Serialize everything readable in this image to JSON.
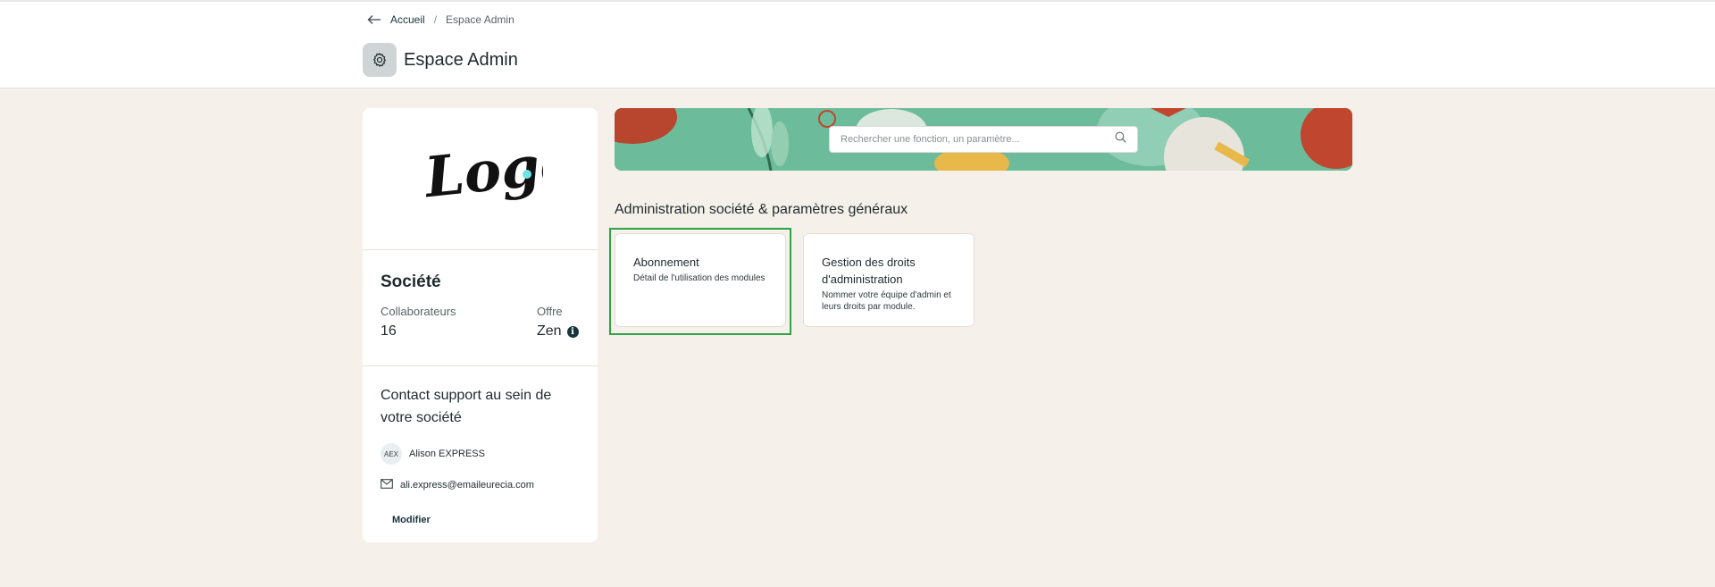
{
  "breadcrumb": {
    "home": "Accueil",
    "separator": "/",
    "current": "Espace Admin"
  },
  "header": {
    "title": "Espace Admin",
    "icon": "gear-icon"
  },
  "company": {
    "logo_text": "Logo",
    "name": "Société",
    "collaborators_label": "Collaborateurs",
    "collaborators_value": "16",
    "offer_label": "Offre",
    "offer_value": "Zen"
  },
  "support": {
    "title": "Contact support au sein de votre société",
    "avatar_initials": "AEX",
    "contact_name": "Alison EXPRESS",
    "email": "ali.express@emaileurecia.com",
    "modify_label": "Modifier"
  },
  "search": {
    "placeholder": "Rechercher une fonction, un paramètre..."
  },
  "section": {
    "title": "Administration société & paramètres généraux"
  },
  "cards": [
    {
      "title": "Abonnement",
      "description": "Détail de l'utilisation des modules"
    },
    {
      "title": "Gestion des droits d'administration",
      "description": "Nommer votre équipe d'admin et leurs droits par module."
    }
  ],
  "colors": {
    "banner": "#6cbc9c",
    "accent": "#17343a",
    "highlight": "#2fa24a",
    "background": "#f5f1ea"
  }
}
